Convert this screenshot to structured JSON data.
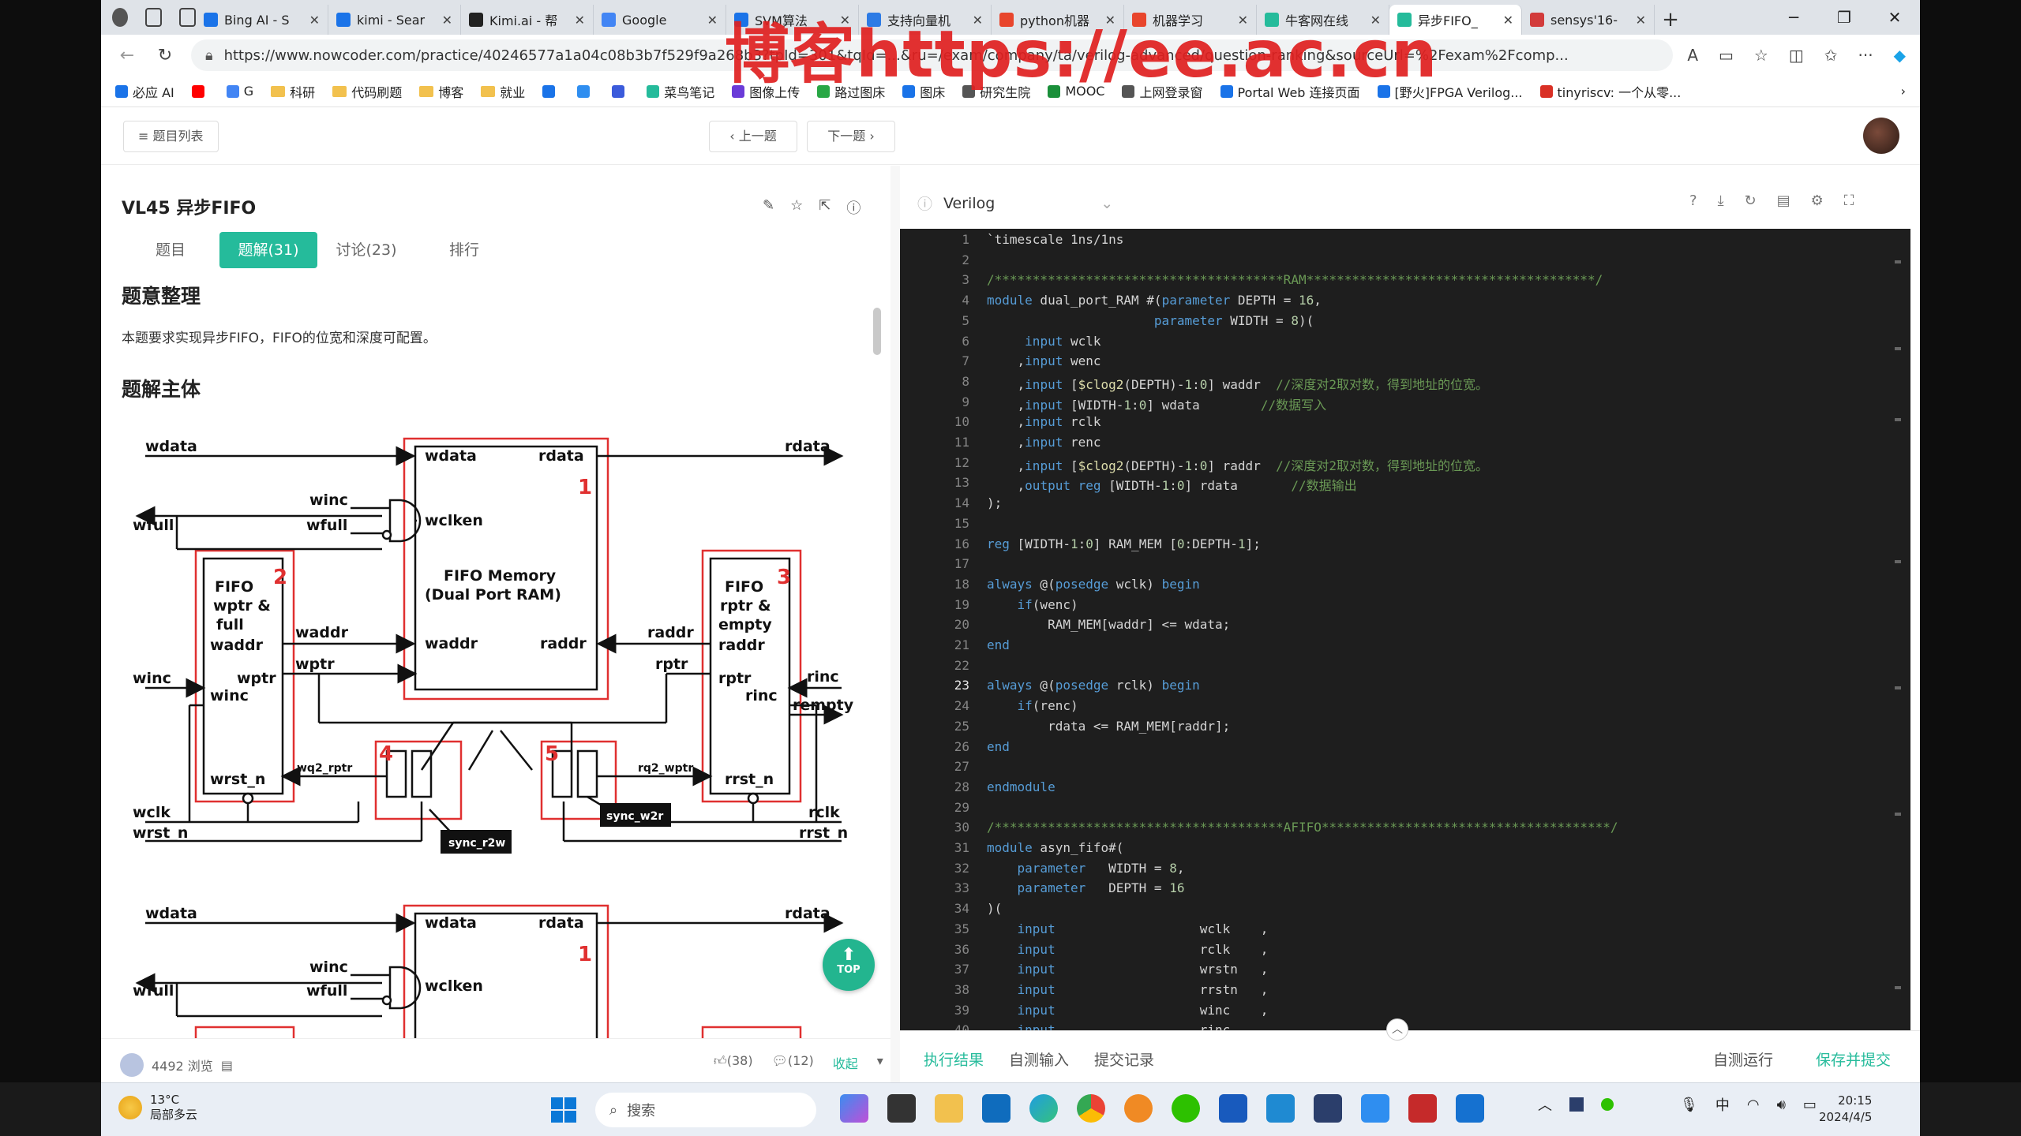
{
  "browser": {
    "tabs": [
      {
        "label": "Bing AI - S",
        "color": "#1a73e8"
      },
      {
        "label": "kimi - Sear",
        "color": "#1a73e8"
      },
      {
        "label": "Kimi.ai - 帮",
        "color": "#222222"
      },
      {
        "label": "Google",
        "color": "#4285f4"
      },
      {
        "label": "SVM算法",
        "color": "#1a73e8"
      },
      {
        "label": "支持向量机",
        "color": "#2d7be5"
      },
      {
        "label": "python机器",
        "color": "#e8452c"
      },
      {
        "label": "机器学习",
        "color": "#e8452c"
      },
      {
        "label": "牛客网在线",
        "color": "#25bb9b"
      },
      {
        "label": "异步FIFO_",
        "color": "#25bb9b"
      },
      {
        "label": "sensys'16-",
        "color": "#d23b3b"
      }
    ],
    "active_tab_index": 9,
    "new_tab": "+",
    "url": "https://www.nowcoder.com/practice/40246577a1a04c08b3b7f529f9a268b3?tpId=301&tqId=...&ru=/exam/company/ta/verilog-advanced/question-ranking&sourceUrl=%2Fexam%2Fcomp...",
    "bookmarks": [
      "必应 AI",
      "",
      "G",
      "科研",
      "代码刷题",
      "博客",
      "就业",
      "",
      "",
      "",
      "菜鸟笔记",
      "图像上传",
      "路过图床",
      "图床",
      "研究生院",
      "MOOC",
      "上网登录窗",
      "Portal Web 连接页面",
      "[野火]FPGA Verilog...",
      "tinyriscv: 一个从零..."
    ]
  },
  "watermark": "博客https://ee.ac.cn",
  "page_header": {
    "list_btn": "≡ 题目列表",
    "prev_btn": "‹ 上一题",
    "next_btn": "下一题 ›"
  },
  "question": {
    "title": "VL45  异步FIFO",
    "tabs": [
      "题目",
      "题解(31)",
      "讨论(23)",
      "排行"
    ],
    "active_tab": 1
  },
  "solution": {
    "h1": "题意整理",
    "p1": "本题要求实现异步FIFO，FIFO的位宽和深度可配置。",
    "h2": "题解主体"
  },
  "diagram": {
    "mem_title": "FIFO Memory",
    "mem_sub": "(Dual Port RAM)",
    "wptr_block": [
      "FIFO",
      "wptr &",
      "full"
    ],
    "rptr_block": [
      "FIFO",
      "rptr &",
      "empty"
    ],
    "sync_r2w": "sync_r2w",
    "sync_w2r": "sync_w2r",
    "signals": {
      "wdata": "wdata",
      "rdata": "rdata",
      "winc": "winc",
      "wfull": "wfull",
      "wclken": "wclken",
      "waddr": "waddr",
      "raddr": "raddr",
      "wptr": "wptr",
      "rptr": "rptr",
      "rinc": "rinc",
      "rempty": "rempty",
      "wclk": "wclk",
      "rclk": "rclk",
      "wrst_n": "wrst_n",
      "rrst_n": "rrst_n",
      "wq2_rptr": "wq2_rptr",
      "rq2_wptr": "rq2_wptr"
    },
    "block_numbers": [
      "1",
      "2",
      "3",
      "4",
      "5"
    ],
    "colors": {
      "red": "#e03030"
    }
  },
  "top_button": "TOP",
  "left_footer": {
    "views": "4492 浏览",
    "likes": "(38)",
    "comments": "(12)",
    "collect": "收起"
  },
  "editor": {
    "language": "Verilog",
    "bottom_tabs": [
      "执行结果",
      "自测输入",
      "提交记录"
    ],
    "run_btn": "自测运行",
    "submit_btn": "保存并提交",
    "current_line": 23,
    "lines": [
      "`timescale 1ns/1ns",
      "",
      "/**************************************RAM**************************************/",
      "module dual_port_RAM #(parameter DEPTH = 16,",
      "                      parameter WIDTH = 8)(",
      "     input wclk",
      "    ,input wenc",
      "    ,input [$clog2(DEPTH)-1:0] waddr  //深度对2取对数，得到地址的位宽。",
      "    ,input [WIDTH-1:0] wdata        //数据写入",
      "    ,input rclk",
      "    ,input renc",
      "    ,input [$clog2(DEPTH)-1:0] raddr  //深度对2取对数，得到地址的位宽。",
      "    ,output reg [WIDTH-1:0] rdata       //数据输出",
      ");",
      "",
      "reg [WIDTH-1:0] RAM_MEM [0:DEPTH-1];",
      "",
      "always @(posedge wclk) begin",
      "    if(wenc)",
      "        RAM_MEM[waddr] <= wdata;",
      "end",
      "",
      "always @(posedge rclk) begin",
      "    if(renc)",
      "        rdata <= RAM_MEM[raddr];",
      "end",
      "",
      "endmodule",
      "",
      "/**************************************AFIFO**************************************/",
      "module asyn_fifo#(",
      "    parameter   WIDTH = 8,",
      "    parameter   DEPTH = 16",
      ")(",
      "    input                   wclk    ,",
      "    input                   rclk    ,",
      "    input                   wrstn   ,",
      "    input                   rrstn   ,",
      "    input                   winc    ,",
      "    input                   rinc    ,"
    ]
  },
  "taskbar": {
    "temp": "13°C",
    "weather": "局部多云",
    "search": "搜索",
    "ime": "中",
    "time": "20:15",
    "date": "2024/4/5"
  }
}
